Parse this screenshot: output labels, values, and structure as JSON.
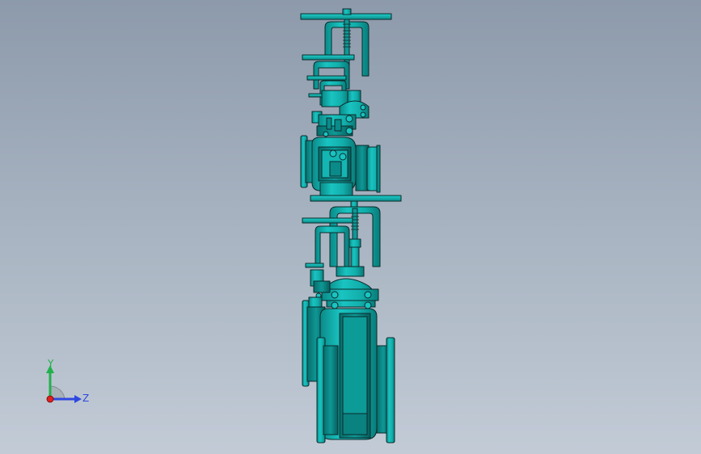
{
  "viewport": {
    "background_top": "#8d9aab",
    "background_bottom": "#c2cbd6"
  },
  "model": {
    "description_color": "#12b3b1",
    "shade_color": "#0a8c8a",
    "edge_color": "#0b2a2a"
  },
  "triad": {
    "y_label": "Y",
    "z_label": "Z",
    "y_color": "#22b14c",
    "z_color": "#2f48e0",
    "x_color": "#e02020"
  }
}
